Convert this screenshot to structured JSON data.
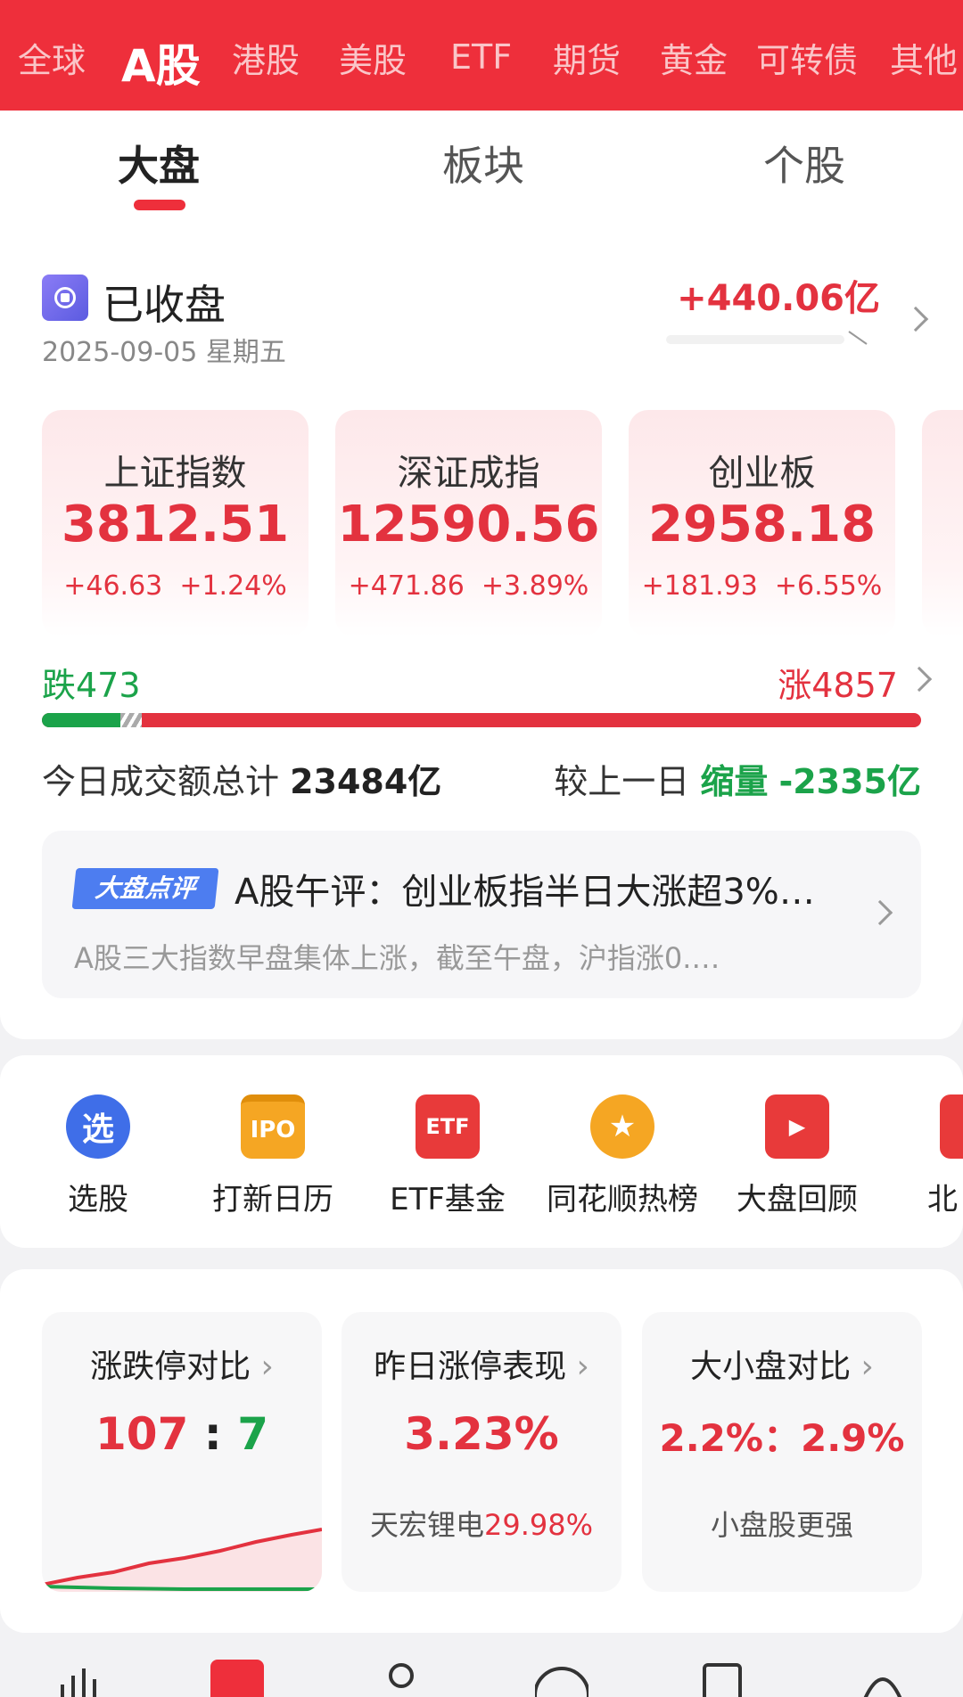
{
  "market_tabs": [
    "全球",
    "A股",
    "港股",
    "美股",
    "ETF",
    "期货",
    "黄金",
    "可转债",
    "其他"
  ],
  "active_market_tab": "A股",
  "sub_tabs": [
    "大盘",
    "板块",
    "个股"
  ],
  "status": {
    "text": "已收盘",
    "date": "2025-09-05 星期五",
    "net_flow": "+440.06亿"
  },
  "indices": [
    {
      "name": "上证指数",
      "value": "3812.51",
      "change": "+46.63",
      "pct": "+1.24%"
    },
    {
      "name": "深证成指",
      "value": "12590.56",
      "change": "+471.86",
      "pct": "+3.89%"
    },
    {
      "name": "创业板",
      "value": "2958.18",
      "change": "+181.93",
      "pct": "+6.55%"
    }
  ],
  "breadth": {
    "down": "跌473",
    "up": "涨4857",
    "down_count": 473,
    "up_count": 4857
  },
  "volume": {
    "label": "今日成交额总计",
    "total": "23484亿",
    "compare_label": "较上一日",
    "compare_tag": "缩量",
    "compare_value": "-2335亿"
  },
  "review": {
    "badge": "大盘点评",
    "title": "A股午评：创业板指半日大涨超3%…",
    "desc": "A股三大指数早盘集体上涨，截至午盘，沪指涨0.…"
  },
  "features": [
    {
      "label": "选股",
      "icon": "select-stock-icon",
      "glyph": "选"
    },
    {
      "label": "打新日历",
      "icon": "ipo-calendar-icon",
      "glyph": "IPO"
    },
    {
      "label": "ETF基金",
      "icon": "etf-fund-icon",
      "glyph": "ETF"
    },
    {
      "label": "同花顺热榜",
      "icon": "hot-list-icon",
      "glyph": "★"
    },
    {
      "label": "大盘回顾",
      "icon": "market-review-icon",
      "glyph": "▶"
    },
    {
      "label": "北",
      "icon": "north-icon",
      "glyph": ""
    }
  ],
  "stats": {
    "limit": {
      "title": "涨跌停对比",
      "up": "107",
      "sep": ":",
      "down": "7"
    },
    "yesterday": {
      "title": "昨日涨停表现",
      "value": "3.23%",
      "stock": "天宏锂电",
      "stock_pct": "29.98%"
    },
    "size": {
      "title": "大小盘对比",
      "value": "2.2%：2.9%",
      "sub": "小盘股更强"
    }
  },
  "colors": {
    "brand_red": "#ee2f3b",
    "up_red": "#e3323f",
    "down_green": "#1ba34a",
    "badge_blue": "#4d7df0"
  }
}
